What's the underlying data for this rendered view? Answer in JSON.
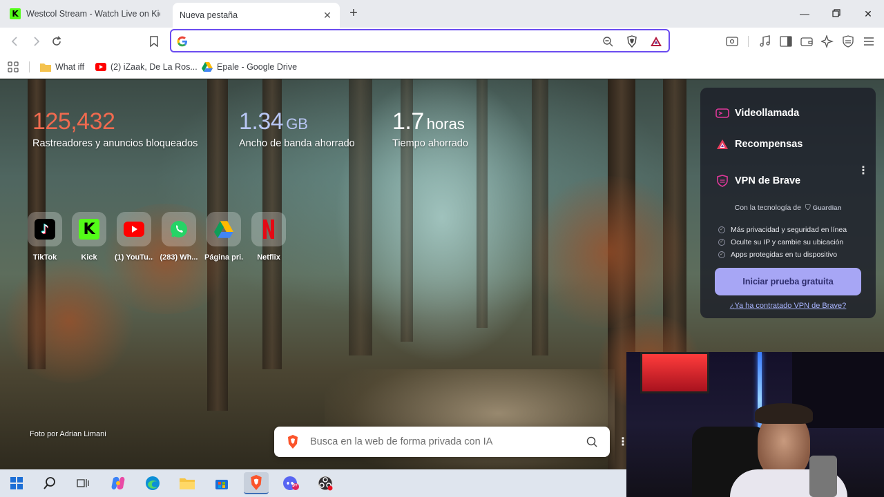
{
  "tabs": [
    {
      "title": "Westcol Stream - Watch Live on Kick",
      "icon": "kick-icon",
      "active": false
    },
    {
      "title": "Nueva pestaña",
      "icon": "none",
      "active": true
    }
  ],
  "toolbar": {
    "address_value": "",
    "address_placeholder": ""
  },
  "bookmarks": [
    {
      "label": "What iff",
      "icon": "folder-icon"
    },
    {
      "label": "(2) iZaak, De La Ros...",
      "icon": "youtube-icon"
    },
    {
      "label": "Epale - Google Drive",
      "icon": "google-drive-icon"
    }
  ],
  "stats": {
    "trackers_value": "125,432",
    "trackers_label": "Rastreadores y anuncios bloqueados",
    "bandwidth_value": "1.34",
    "bandwidth_unit": "GB",
    "bandwidth_label": "Ancho de banda ahorrado",
    "time_value": "1.7",
    "time_unit": "horas",
    "time_label": "Tiempo ahorrado"
  },
  "top_sites": [
    {
      "label": "TikTok",
      "icon": "tiktok-icon"
    },
    {
      "label": "Kick",
      "icon": "kick-icon"
    },
    {
      "label": "(1) YouTu...",
      "icon": "youtube-icon"
    },
    {
      "label": "(283) Wh...",
      "icon": "whatsapp-icon"
    },
    {
      "label": "Página pri...",
      "icon": "google-drive-icon"
    },
    {
      "label": "Netflix",
      "icon": "netflix-icon"
    }
  ],
  "photo_credit": "Foto por Adrian Limani",
  "search": {
    "placeholder": "Busca en la web de forma privada con IA"
  },
  "vpn_panel": {
    "videocall": "Videollamada",
    "rewards": "Recompensas",
    "vpn_title": "VPN de Brave",
    "tech_text": "Con la tecnología de",
    "tech_brand": "Guardian",
    "features": [
      "Más privacidad y seguridad en línea",
      "Oculte su IP y cambie su ubicación",
      "Apps protegidas en tu dispositivo"
    ],
    "trial_button": "Iniciar prueba gratuita",
    "contracted_link": "¿Ya ha contratado VPN de Brave?"
  },
  "taskbar": {
    "apps": [
      "windows-start-icon",
      "search-icon",
      "task-view-icon",
      "copilot-icon",
      "edge-icon",
      "file-explorer-icon",
      "store-icon",
      "brave-icon",
      "discord-icon",
      "obs-icon"
    ],
    "active_app": "brave-icon",
    "discord_badge": "9+"
  },
  "colors": {
    "accent": "#6b4cf0",
    "trackers": "#f06a4f",
    "bandwidth": "#b8c6f4",
    "trial_button": "#a7a6f5",
    "brave_orange": "#fb542b",
    "kick_green": "#53fc18"
  }
}
